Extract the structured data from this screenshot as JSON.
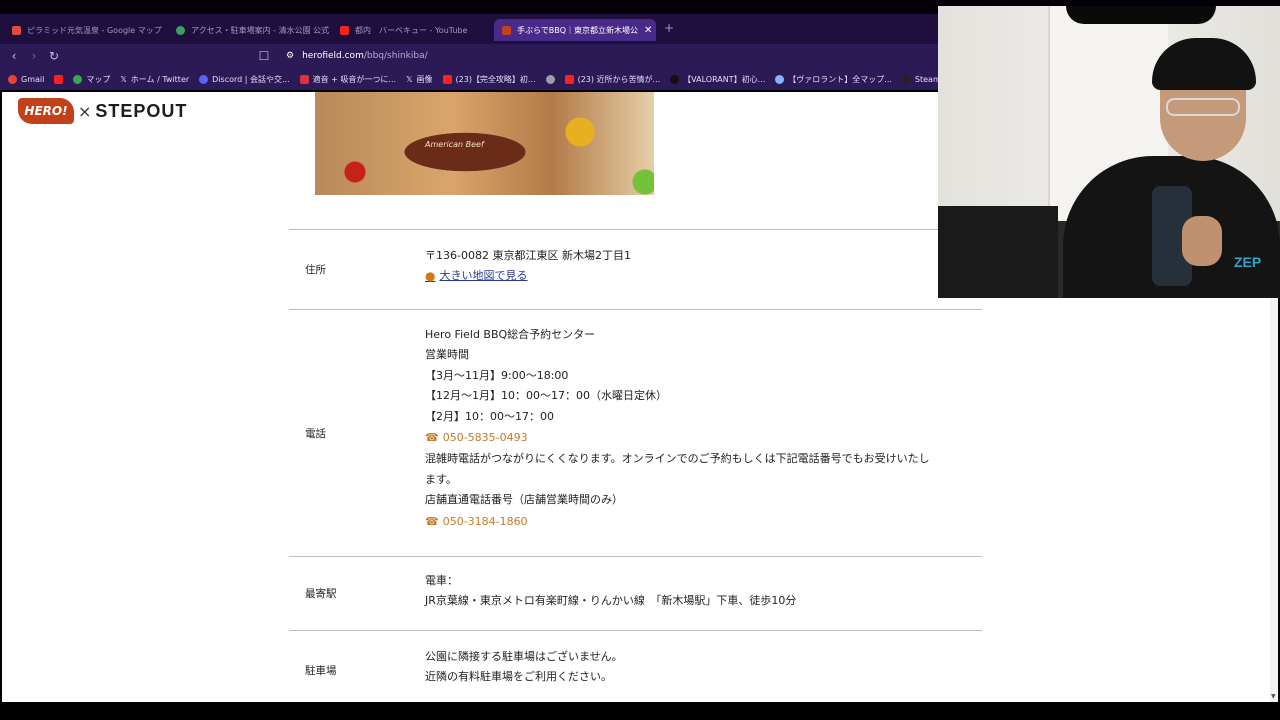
{
  "browser": {
    "tabs": [
      {
        "label": "ピラミッド元気温泉 - Google マップ",
        "icon_color": "#e24a3b",
        "active": false
      },
      {
        "label": "アクセス・駐車場案内 - 清水公園 公式",
        "icon_color": "#3aa35a",
        "active": false
      },
      {
        "label": "都内　バーベキュー - YouTube",
        "icon_color": "#ff2020",
        "active": false
      },
      {
        "label": "手ぶらでBBQ｜東京都立新木場公",
        "icon_color": "#c2411a",
        "active": true
      }
    ],
    "close_glyph": "✕",
    "new_tab_glyph": "+",
    "url_host": "herofield.com",
    "url_path": "/bbq/shinkiba/",
    "bookmarks": [
      {
        "label": "Gmail",
        "color": "#ea4335"
      },
      {
        "label": "",
        "color": "#ff2020"
      },
      {
        "label": "マップ",
        "color": "#34a853"
      },
      {
        "label": "ホーム / Twitter",
        "color": "#ffffff"
      },
      {
        "label": "Discord | 会話や交...",
        "color": "#5865f2"
      },
      {
        "label": "適音 + 吸音が一つに...",
        "color": "#e0303a"
      },
      {
        "label": "画像",
        "color": "#ffffff"
      },
      {
        "label": "(23)【完全攻略】初...",
        "color": "#ff2020"
      },
      {
        "label": "",
        "color": "#9aa0a6"
      },
      {
        "label": "(23) 近所から苦情が...",
        "color": "#ff2020"
      },
      {
        "label": "【VALORANT】初心...",
        "color": "#111111"
      },
      {
        "label": "【ヴァロラント】全マップ...",
        "color": "#8ab4f8"
      },
      {
        "label": "SteamDB",
        "color": "#222222"
      }
    ]
  },
  "site": {
    "logo_hero": "HERO!",
    "logo_x": "×",
    "logo_step": "STEPOUT",
    "image_text": "American Beef"
  },
  "info": {
    "address": {
      "label": "住所",
      "postal": "〒136-0082 東京都江東区 新木場2丁目1",
      "map_link": "大きい地図で見る"
    },
    "tel": {
      "label": "電話",
      "lines_before": [
        "Hero Field BBQ総合予約センター",
        "営業時間",
        "【3月～11月】9:00～18:00",
        "【12月～1月】10：00～17：00（水曜日定休）",
        "【2月】10：00～17：00"
      ],
      "phone1": "050-5835-0493",
      "lines_middle": [
        "混雑時電話がつながりにくくなります。オンラインでのご予約もしくは下記電話番号でもお受けいたし",
        "ます。",
        "店舗直通電話番号（店舗営業時間のみ）"
      ],
      "phone2": "050-3184-1860"
    },
    "station": {
      "label": "最寄駅",
      "line1": "電車：",
      "line2": "JR京葉線・東京メトロ有楽町線・りんかい線　「新木場駅」下車、徒歩10分"
    },
    "parking": {
      "label": "駐車場",
      "line1": "公園に隣接する駐車場はございません。",
      "line2": "近隣の有料駐車場をご利用ください。"
    }
  },
  "webcam": {
    "shirt_text": "ZEP"
  }
}
